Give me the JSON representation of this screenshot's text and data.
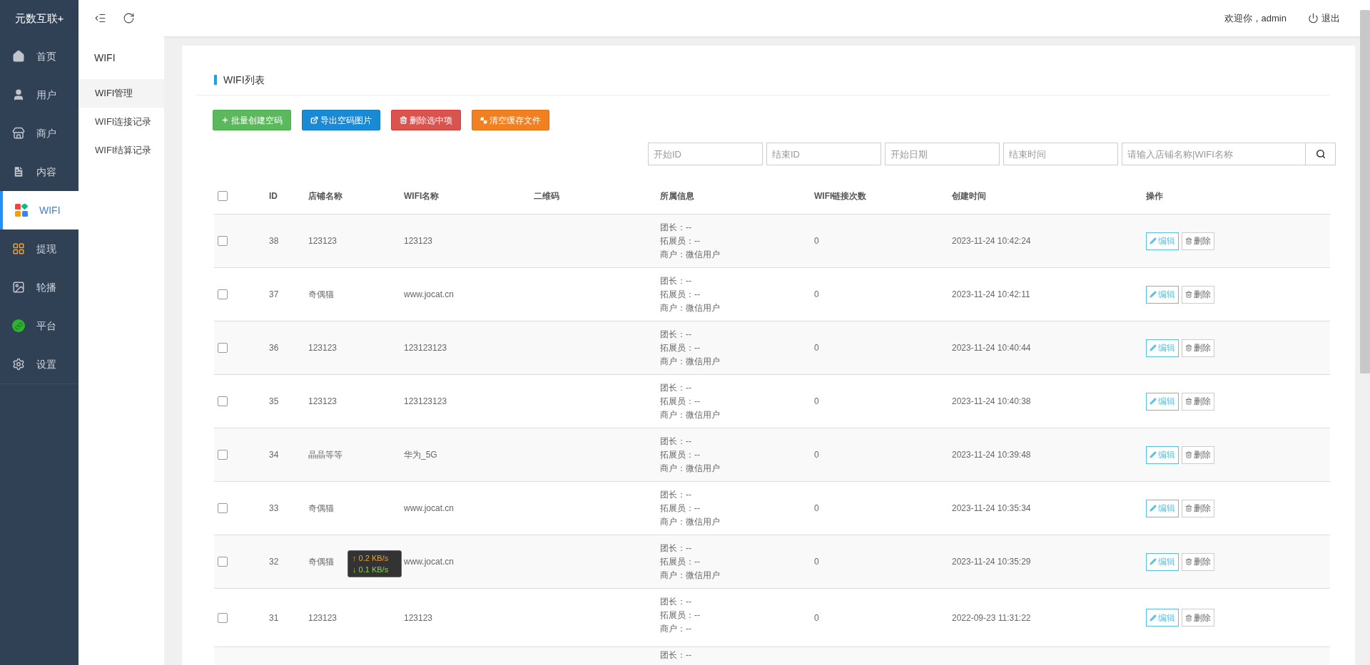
{
  "brand": "元数互联+",
  "sidebar": {
    "items": [
      {
        "label": "首页",
        "selected": false
      },
      {
        "label": "用户",
        "selected": false
      },
      {
        "label": "商户",
        "selected": false
      },
      {
        "label": "内容",
        "selected": false
      },
      {
        "label": "WIFI",
        "selected": true
      },
      {
        "label": "提现",
        "selected": false
      },
      {
        "label": "轮播",
        "selected": false
      },
      {
        "label": "平台",
        "selected": false
      },
      {
        "label": "设置",
        "selected": false
      }
    ]
  },
  "submenu": {
    "title": "WIFI",
    "items": [
      {
        "label": "WIFI管理",
        "selected": true
      },
      {
        "label": "WIFI连接记录",
        "selected": false
      },
      {
        "label": "WIFI结算记录",
        "selected": false
      }
    ]
  },
  "header": {
    "welcome": "欢迎你，admin",
    "logout": "退出"
  },
  "panel": {
    "title": "WIFI列表",
    "actions": [
      {
        "label": "批量创建空码",
        "kind": "create"
      },
      {
        "label": "导出空码图片",
        "kind": "export"
      },
      {
        "label": "删除选中项",
        "kind": "delete"
      },
      {
        "label": "清空缓存文件",
        "kind": "clear"
      }
    ],
    "filters": [
      {
        "placeholder": "开始ID"
      },
      {
        "placeholder": "结束ID"
      },
      {
        "placeholder": "开始日期"
      },
      {
        "placeholder": "结束时间"
      }
    ],
    "search": {
      "placeholder": "请输入店铺名称|WIFI名称"
    }
  },
  "table": {
    "header_checked": false,
    "columns": [
      "ID",
      "店铺名称",
      "WIFI名称",
      "二维码",
      "所属信息",
      "WIFI链接次数",
      "创建时间",
      "操作"
    ],
    "rows": [
      {
        "checked": false,
        "id": "38",
        "store": "123123",
        "wifi": "123123",
        "info": [
          "团长：--",
          "拓展员：--",
          "商户：微信用户"
        ],
        "count": "0",
        "created": "2023-11-24 10:42:24",
        "edit": "编辑",
        "delete": "删除"
      },
      {
        "checked": false,
        "id": "37",
        "store": "奇偶猫",
        "wifi": "www.jocat.cn",
        "info": [
          "团长：--",
          "拓展员：--",
          "商户：微信用户"
        ],
        "count": "0",
        "created": "2023-11-24 10:42:11",
        "edit": "编辑",
        "delete": "删除"
      },
      {
        "checked": false,
        "id": "36",
        "store": "123123",
        "wifi": "123123123",
        "info": [
          "团长：--",
          "拓展员：--",
          "商户：微信用户"
        ],
        "count": "0",
        "created": "2023-11-24 10:40:44",
        "edit": "编辑",
        "delete": "删除"
      },
      {
        "checked": false,
        "id": "35",
        "store": "123123",
        "wifi": "123123123",
        "info": [
          "团长：--",
          "拓展员：--",
          "商户：微信用户"
        ],
        "count": "0",
        "created": "2023-11-24 10:40:38",
        "edit": "编辑",
        "delete": "删除"
      },
      {
        "checked": false,
        "id": "34",
        "store": "晶晶等等",
        "wifi": "华为_5G",
        "info": [
          "团长：--",
          "拓展员：--",
          "商户：微信用户"
        ],
        "count": "0",
        "created": "2023-11-24 10:39:48",
        "edit": "编辑",
        "delete": "删除"
      },
      {
        "checked": false,
        "id": "33",
        "store": "奇偶猫",
        "wifi": "www.jocat.cn",
        "info": [
          "团长：--",
          "拓展员：--",
          "商户：微信用户"
        ],
        "count": "0",
        "created": "2023-11-24 10:35:34",
        "edit": "编辑",
        "delete": "删除"
      },
      {
        "checked": false,
        "id": "32",
        "store": "奇偶猫",
        "wifi": "www.jocat.cn",
        "info": [
          "团长：--",
          "拓展员：--",
          "商户：微信用户"
        ],
        "count": "0",
        "created": "2023-11-24 10:35:29",
        "edit": "编辑",
        "delete": "删除"
      },
      {
        "checked": false,
        "id": "31",
        "store": "123123",
        "wifi": "123123",
        "info": [
          "团长：--",
          "拓展员：--",
          "商户：--"
        ],
        "count": "0",
        "created": "2022-09-23 11:31:22",
        "edit": "编辑",
        "delete": "删除"
      },
      {
        "info": [
          "团长：--"
        ]
      }
    ]
  },
  "net_monitor": {
    "upload": "↑ 0.2 KB/s",
    "download": "↓ 0.1 KB/s"
  }
}
